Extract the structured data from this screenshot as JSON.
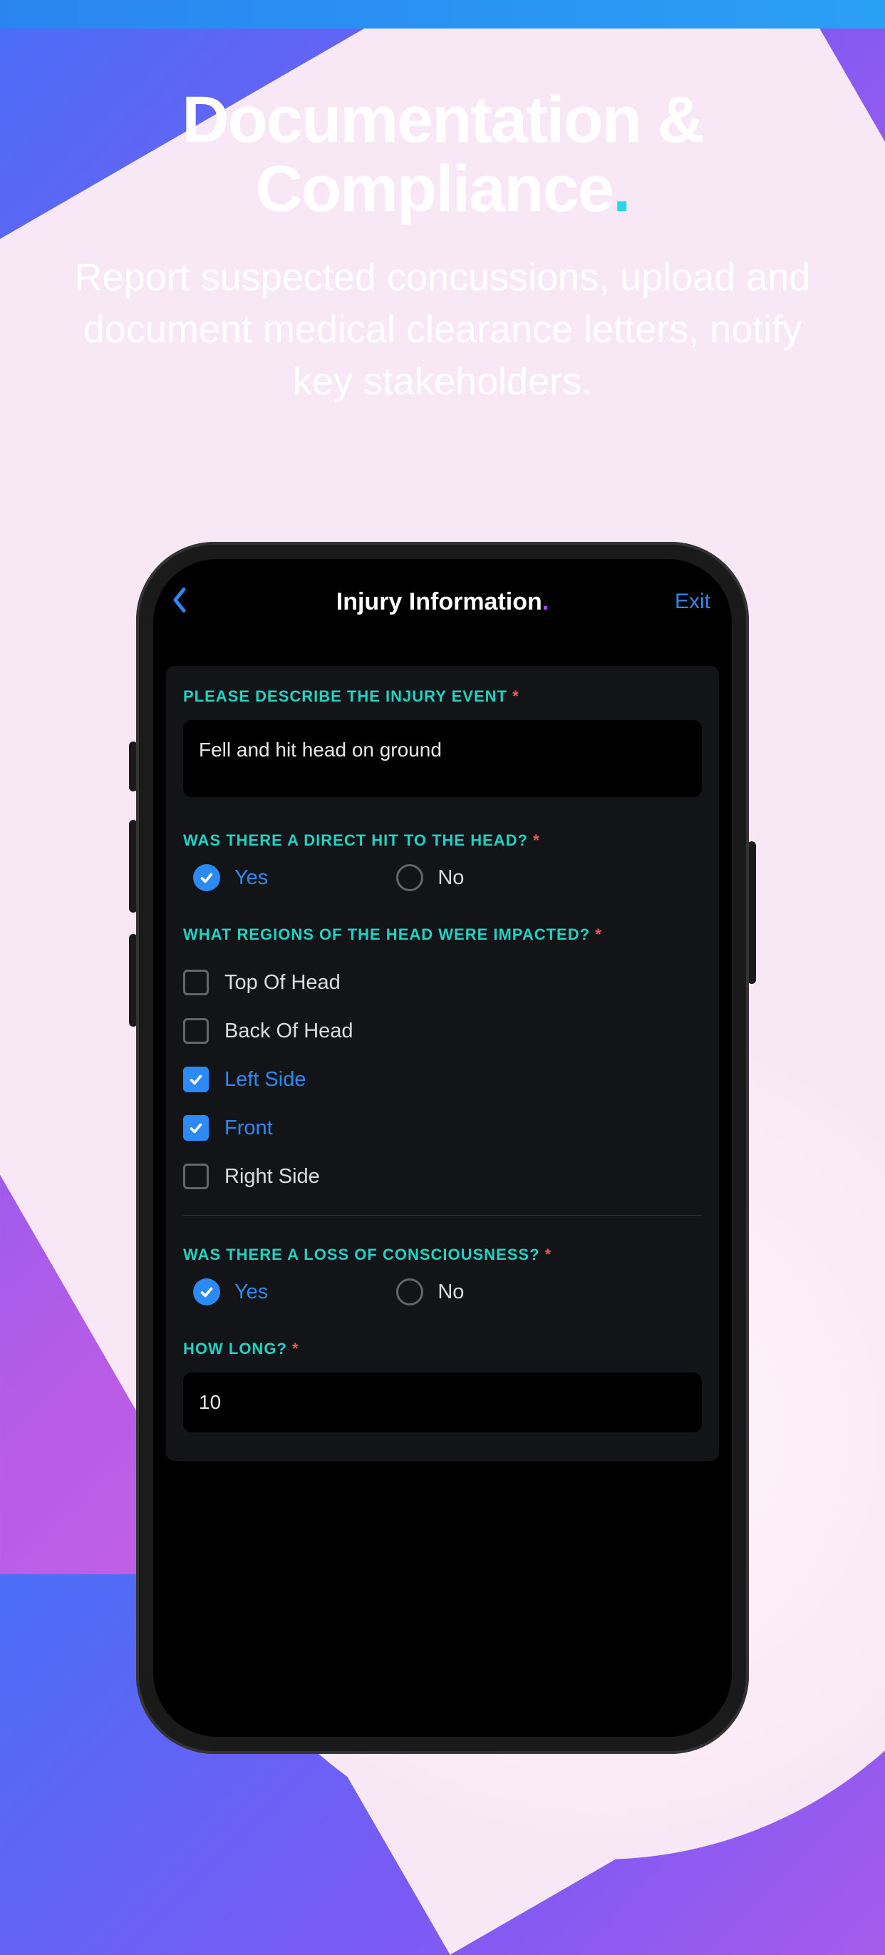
{
  "hero": {
    "title_line1": "Documentation &",
    "title_line2": "Compliance",
    "subtitle": "Report suspected concussions, upload and document medical clearance letters, notify key stakeholders."
  },
  "nav": {
    "title": "Injury Information",
    "exit": "Exit"
  },
  "form": {
    "q1_label": "PLEASE DESCRIBE THE INJURY EVENT",
    "q1_value": "Fell and hit head on ground",
    "q2_label": "WAS THERE A DIRECT HIT TO THE HEAD?",
    "q2_options": {
      "yes": "Yes",
      "no": "No"
    },
    "q2_selected": "yes",
    "q3_label": "WHAT REGIONS OF THE HEAD WERE IMPACTED?",
    "q3_options": [
      {
        "label": "Top Of Head",
        "checked": false
      },
      {
        "label": "Back Of Head",
        "checked": false
      },
      {
        "label": "Left Side",
        "checked": true
      },
      {
        "label": "Front",
        "checked": true
      },
      {
        "label": "Right Side",
        "checked": false
      }
    ],
    "q4_label": "WAS THERE A LOSS OF CONSCIOUSNESS?",
    "q4_options": {
      "yes": "Yes",
      "no": "No"
    },
    "q4_selected": "yes",
    "q5_label": "HOW LONG?",
    "q5_value": "10"
  }
}
